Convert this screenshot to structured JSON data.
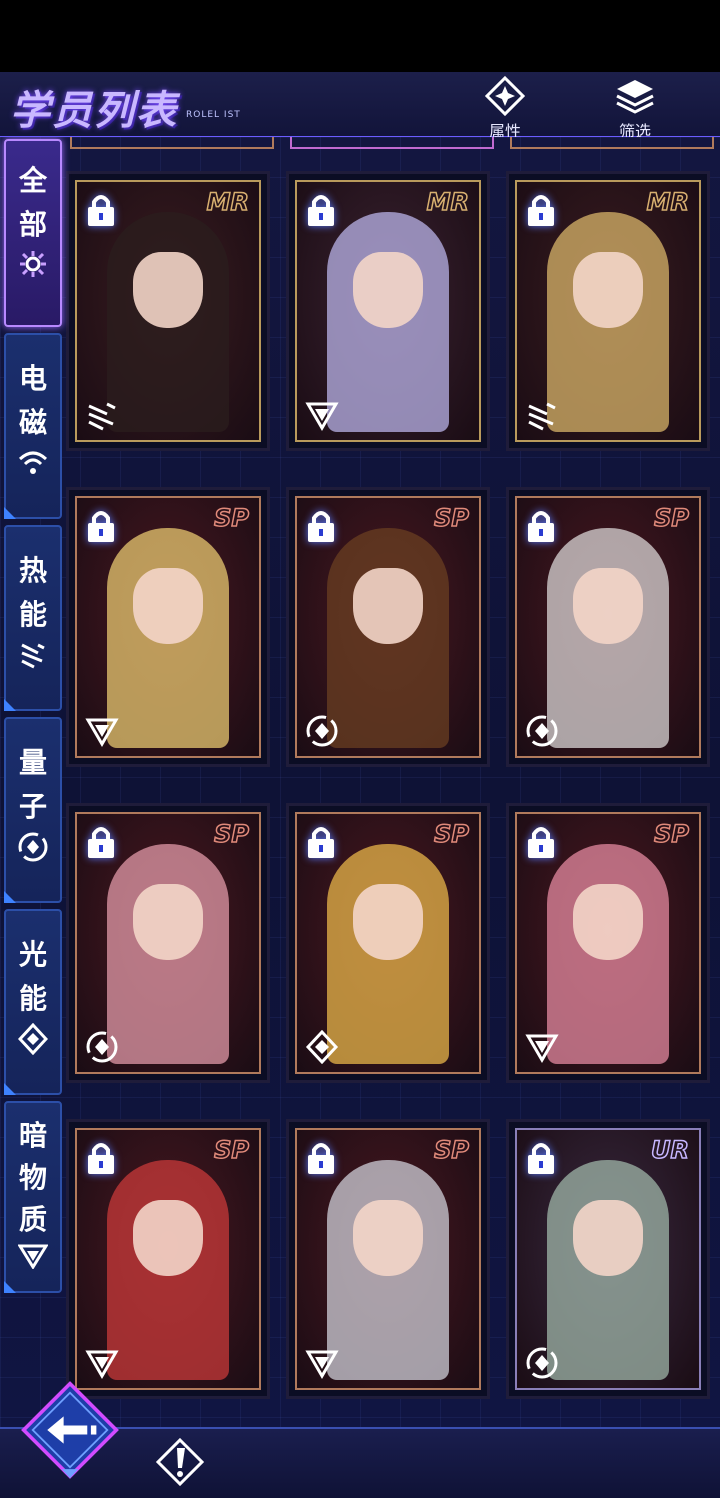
{
  "header": {
    "title": "学员列表",
    "subtitle": "ROLEL IST",
    "attributes_label": "属性",
    "filter_label": "筛选"
  },
  "sidebar": [
    {
      "label_1": "全",
      "label_2": "部",
      "icon": "all-element-icon",
      "active": true
    },
    {
      "label_1": "电",
      "label_2": "磁",
      "icon": "electromagnetic-wifi-icon",
      "active": false
    },
    {
      "label_1": "热",
      "label_2": "能",
      "icon": "thermal-lines-icon",
      "active": false
    },
    {
      "label_1": "量",
      "label_2": "子",
      "icon": "quantum-circle-icon",
      "active": false
    },
    {
      "label_1": "光",
      "label_2": "能",
      "icon": "light-diamond-icon",
      "active": false
    },
    {
      "label_1": "暗",
      "label_2": "物",
      "label_3": "质",
      "icon": "dark-matter-triangle-icon",
      "active": false
    }
  ],
  "cards": [
    {
      "rarity": "MR",
      "element": "thermal",
      "locked": true,
      "hair": "#2b1d1d",
      "bg": "#3a1c1f"
    },
    {
      "rarity": "MR",
      "element": "dark",
      "locked": true,
      "hair": "#b9b3e8",
      "bg": "#3a2230"
    },
    {
      "rarity": "MR",
      "element": "thermal",
      "locked": true,
      "hair": "#d8b46a",
      "bg": "#3a1c1f"
    },
    {
      "rarity": "SP",
      "element": "dark",
      "locked": true,
      "hair": "#e8c870",
      "bg": "#4a1820"
    },
    {
      "rarity": "SP",
      "element": "quantum",
      "locked": true,
      "hair": "#6a3f22",
      "bg": "#4a1820"
    },
    {
      "rarity": "SP",
      "element": "quantum",
      "locked": true,
      "hair": "#d9d6d6",
      "bg": "#4a1820"
    },
    {
      "rarity": "SP",
      "element": "quantum",
      "locked": true,
      "hair": "#e29aa8",
      "bg": "#4a1820"
    },
    {
      "rarity": "SP",
      "element": "light",
      "locked": true,
      "hair": "#e8b64a",
      "bg": "#4a1820"
    },
    {
      "rarity": "SP",
      "element": "dark",
      "locked": true,
      "hair": "#e48aa0",
      "bg": "#4a1820"
    },
    {
      "rarity": "SP",
      "element": "dark",
      "locked": true,
      "hair": "#c83a3a",
      "bg": "#4a1820"
    },
    {
      "rarity": "SP",
      "element": "dark",
      "locked": true,
      "hair": "#cfcfd8",
      "bg": "#4a1820"
    },
    {
      "rarity": "UR",
      "element": "quantum",
      "locked": true,
      "hair": "#9fb6a8",
      "bg": "#3a2a40"
    }
  ],
  "footer": {
    "back_icon": "back-arrow-icon",
    "alert_icon": "exclamation-icon"
  },
  "colors": {
    "accent": "#7b4dff",
    "frame_sp": "#b07a5c",
    "lock": "#ffffff"
  }
}
